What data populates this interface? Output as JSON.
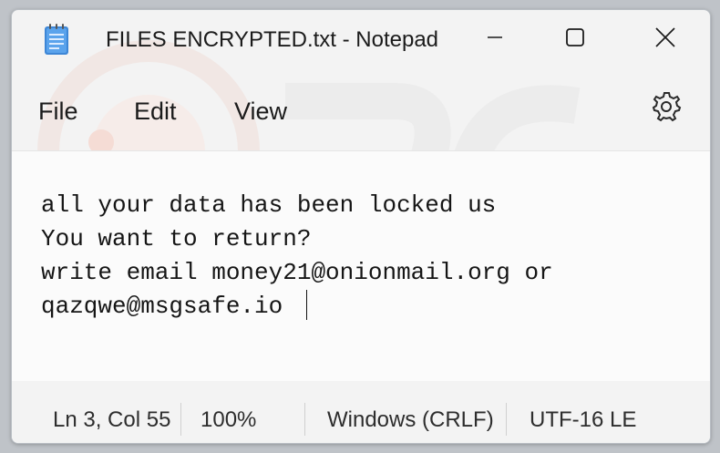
{
  "window": {
    "title": "FILES ENCRYPTED.txt - Notepad"
  },
  "caption_buttons": {
    "minimize_icon": "minimize-icon",
    "maximize_icon": "maximize-icon",
    "close_icon": "close-icon"
  },
  "menu": {
    "file": "File",
    "edit": "Edit",
    "view": "View",
    "settings_icon": "gear-icon"
  },
  "editor": {
    "lines": [
      "all your data has been locked us",
      "You want to return?",
      "write email money21@onionmail.org or",
      "qazqwe@msgsafe.io"
    ]
  },
  "status": {
    "position": "Ln 3, Col 55",
    "zoom": "100%",
    "line_endings": "Windows (CRLF)",
    "encoding": "UTF-16 LE"
  },
  "colors": {
    "background": "#f3f3f3",
    "editor_background": "#fbfbfb",
    "text": "#151515"
  }
}
